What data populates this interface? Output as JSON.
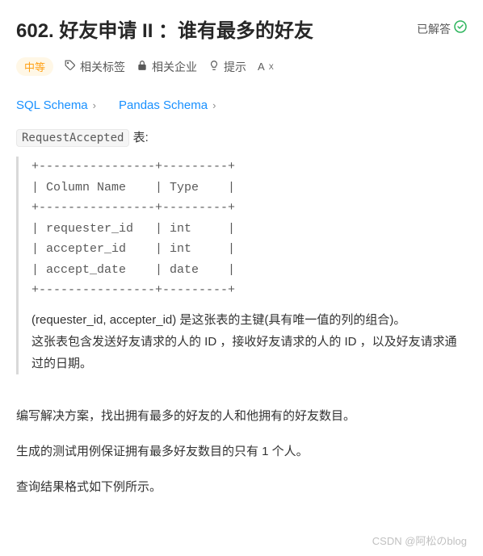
{
  "title": "602. 好友申请 II ：谁有最多的好友",
  "solved_label": "已解答",
  "difficulty": "中等",
  "tags": {
    "related_tags": "相关标签",
    "related_companies": "相关企业",
    "hint": "提示"
  },
  "schemas": {
    "sql": "SQL Schema",
    "pandas": "Pandas Schema"
  },
  "table_name": "RequestAccepted",
  "table_suffix": " 表:",
  "table_diagram": "+----------------+---------+\n| Column Name    | Type    |\n+----------------+---------+\n| requester_id   | int     |\n| accepter_id    | int     |\n| accept_date    | date    |\n+----------------+---------+",
  "table_desc1": "(requester_id, accepter_id) 是这张表的主键(具有唯一值的列的组合)。",
  "table_desc2": "这张表包含发送好友请求的人的 ID ，接收好友请求的人的 ID ，以及好友请求通过的日期。",
  "body1": "编写解决方案，找出拥有最多的好友的人和他拥有的好友数目。",
  "body2": "生成的测试用例保证拥有最多好友数目的只有 1 个人。",
  "body3": "查询结果格式如下例所示。",
  "watermark": "CSDN @阿松のblog"
}
